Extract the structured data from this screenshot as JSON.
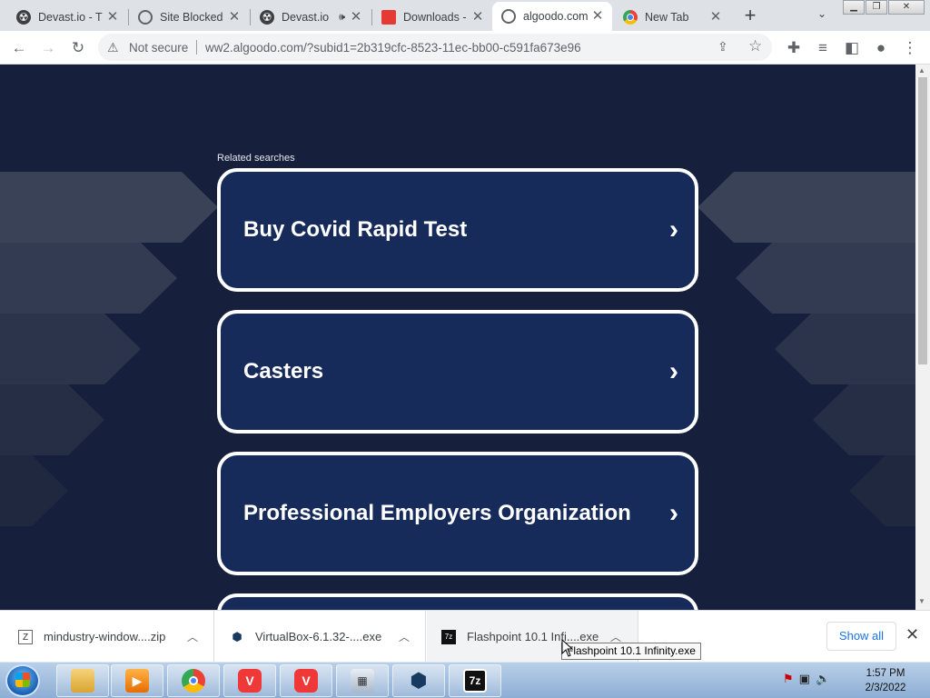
{
  "tabs": [
    {
      "title": "Devast.io - T",
      "favicon": "radioactive-icon",
      "active": false
    },
    {
      "title": "Site Blocked",
      "favicon": "globe-icon",
      "active": false
    },
    {
      "title": "Devast.io",
      "favicon": "radioactive-icon",
      "active": false,
      "audio_icon": "🕪"
    },
    {
      "title": "Downloads -",
      "favicon": "downloads-icon",
      "active": false
    },
    {
      "title": "algoodo.com",
      "favicon": "globe-icon",
      "active": true
    },
    {
      "title": "New Tab",
      "favicon": "chrome-icon",
      "active": false
    }
  ],
  "toolbar": {
    "security_label": "Not secure",
    "url": "ww2.algoodo.com/?subid1=2b319cfc-8523-11ec-bb00-c591fa673e96"
  },
  "page": {
    "related_label": "Related searches",
    "cards": [
      {
        "text": "Buy Covid Rapid Test"
      },
      {
        "text": "Casters"
      },
      {
        "text": "Professional Employers Organization"
      },
      {
        "text": ""
      }
    ],
    "colors": {
      "background": "#16203d",
      "card": "#162b5a",
      "card_border": "#ffffff"
    }
  },
  "downloads": {
    "items": [
      {
        "name": "mindustry-window....zip",
        "icon": "zip-icon"
      },
      {
        "name": "VirtualBox-6.1.32-....exe",
        "icon": "virtualbox-icon"
      },
      {
        "name": "Flashpoint 10.1 Infi....exe",
        "icon": "7zip-icon"
      }
    ],
    "show_all": "Show all",
    "tooltip": "Flashpoint 10.1 Infinity.exe"
  },
  "taskbar": {
    "apps": [
      {
        "name": "explorer-icon"
      },
      {
        "name": "media-player-icon"
      },
      {
        "name": "chrome-icon"
      },
      {
        "name": "vivaldi-icon",
        "label": "V"
      },
      {
        "name": "vivaldi-icon",
        "label": "V"
      },
      {
        "name": "calculator-icon"
      },
      {
        "name": "virtualbox-icon"
      },
      {
        "name": "7zip-icon",
        "label": "7z"
      }
    ],
    "time": "1:57 PM",
    "date": "2/3/2022"
  }
}
